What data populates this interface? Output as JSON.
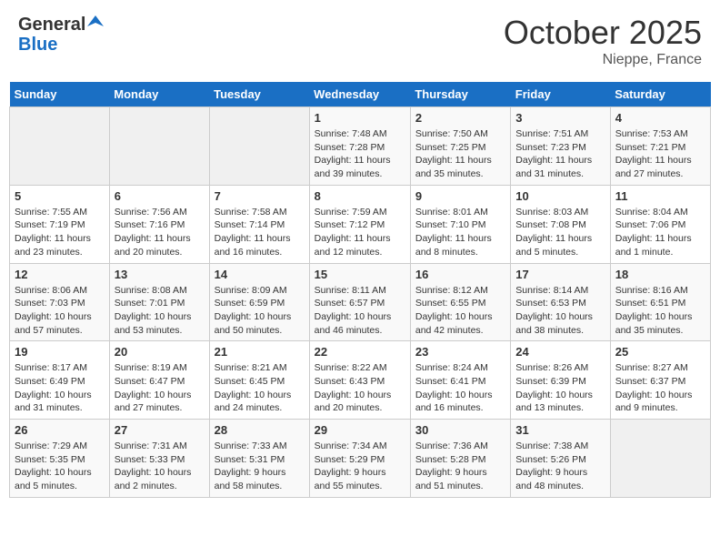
{
  "header": {
    "logo_general": "General",
    "logo_blue": "Blue",
    "month": "October 2025",
    "location": "Nieppe, France"
  },
  "days_of_week": [
    "Sunday",
    "Monday",
    "Tuesday",
    "Wednesday",
    "Thursday",
    "Friday",
    "Saturday"
  ],
  "weeks": [
    [
      {
        "num": "",
        "info": ""
      },
      {
        "num": "",
        "info": ""
      },
      {
        "num": "",
        "info": ""
      },
      {
        "num": "1",
        "info": "Sunrise: 7:48 AM\nSunset: 7:28 PM\nDaylight: 11 hours\nand 39 minutes."
      },
      {
        "num": "2",
        "info": "Sunrise: 7:50 AM\nSunset: 7:25 PM\nDaylight: 11 hours\nand 35 minutes."
      },
      {
        "num": "3",
        "info": "Sunrise: 7:51 AM\nSunset: 7:23 PM\nDaylight: 11 hours\nand 31 minutes."
      },
      {
        "num": "4",
        "info": "Sunrise: 7:53 AM\nSunset: 7:21 PM\nDaylight: 11 hours\nand 27 minutes."
      }
    ],
    [
      {
        "num": "5",
        "info": "Sunrise: 7:55 AM\nSunset: 7:19 PM\nDaylight: 11 hours\nand 23 minutes."
      },
      {
        "num": "6",
        "info": "Sunrise: 7:56 AM\nSunset: 7:16 PM\nDaylight: 11 hours\nand 20 minutes."
      },
      {
        "num": "7",
        "info": "Sunrise: 7:58 AM\nSunset: 7:14 PM\nDaylight: 11 hours\nand 16 minutes."
      },
      {
        "num": "8",
        "info": "Sunrise: 7:59 AM\nSunset: 7:12 PM\nDaylight: 11 hours\nand 12 minutes."
      },
      {
        "num": "9",
        "info": "Sunrise: 8:01 AM\nSunset: 7:10 PM\nDaylight: 11 hours\nand 8 minutes."
      },
      {
        "num": "10",
        "info": "Sunrise: 8:03 AM\nSunset: 7:08 PM\nDaylight: 11 hours\nand 5 minutes."
      },
      {
        "num": "11",
        "info": "Sunrise: 8:04 AM\nSunset: 7:06 PM\nDaylight: 11 hours\nand 1 minute."
      }
    ],
    [
      {
        "num": "12",
        "info": "Sunrise: 8:06 AM\nSunset: 7:03 PM\nDaylight: 10 hours\nand 57 minutes."
      },
      {
        "num": "13",
        "info": "Sunrise: 8:08 AM\nSunset: 7:01 PM\nDaylight: 10 hours\nand 53 minutes."
      },
      {
        "num": "14",
        "info": "Sunrise: 8:09 AM\nSunset: 6:59 PM\nDaylight: 10 hours\nand 50 minutes."
      },
      {
        "num": "15",
        "info": "Sunrise: 8:11 AM\nSunset: 6:57 PM\nDaylight: 10 hours\nand 46 minutes."
      },
      {
        "num": "16",
        "info": "Sunrise: 8:12 AM\nSunset: 6:55 PM\nDaylight: 10 hours\nand 42 minutes."
      },
      {
        "num": "17",
        "info": "Sunrise: 8:14 AM\nSunset: 6:53 PM\nDaylight: 10 hours\nand 38 minutes."
      },
      {
        "num": "18",
        "info": "Sunrise: 8:16 AM\nSunset: 6:51 PM\nDaylight: 10 hours\nand 35 minutes."
      }
    ],
    [
      {
        "num": "19",
        "info": "Sunrise: 8:17 AM\nSunset: 6:49 PM\nDaylight: 10 hours\nand 31 minutes."
      },
      {
        "num": "20",
        "info": "Sunrise: 8:19 AM\nSunset: 6:47 PM\nDaylight: 10 hours\nand 27 minutes."
      },
      {
        "num": "21",
        "info": "Sunrise: 8:21 AM\nSunset: 6:45 PM\nDaylight: 10 hours\nand 24 minutes."
      },
      {
        "num": "22",
        "info": "Sunrise: 8:22 AM\nSunset: 6:43 PM\nDaylight: 10 hours\nand 20 minutes."
      },
      {
        "num": "23",
        "info": "Sunrise: 8:24 AM\nSunset: 6:41 PM\nDaylight: 10 hours\nand 16 minutes."
      },
      {
        "num": "24",
        "info": "Sunrise: 8:26 AM\nSunset: 6:39 PM\nDaylight: 10 hours\nand 13 minutes."
      },
      {
        "num": "25",
        "info": "Sunrise: 8:27 AM\nSunset: 6:37 PM\nDaylight: 10 hours\nand 9 minutes."
      }
    ],
    [
      {
        "num": "26",
        "info": "Sunrise: 7:29 AM\nSunset: 5:35 PM\nDaylight: 10 hours\nand 5 minutes."
      },
      {
        "num": "27",
        "info": "Sunrise: 7:31 AM\nSunset: 5:33 PM\nDaylight: 10 hours\nand 2 minutes."
      },
      {
        "num": "28",
        "info": "Sunrise: 7:33 AM\nSunset: 5:31 PM\nDaylight: 9 hours\nand 58 minutes."
      },
      {
        "num": "29",
        "info": "Sunrise: 7:34 AM\nSunset: 5:29 PM\nDaylight: 9 hours\nand 55 minutes."
      },
      {
        "num": "30",
        "info": "Sunrise: 7:36 AM\nSunset: 5:28 PM\nDaylight: 9 hours\nand 51 minutes."
      },
      {
        "num": "31",
        "info": "Sunrise: 7:38 AM\nSunset: 5:26 PM\nDaylight: 9 hours\nand 48 minutes."
      },
      {
        "num": "",
        "info": ""
      }
    ]
  ]
}
